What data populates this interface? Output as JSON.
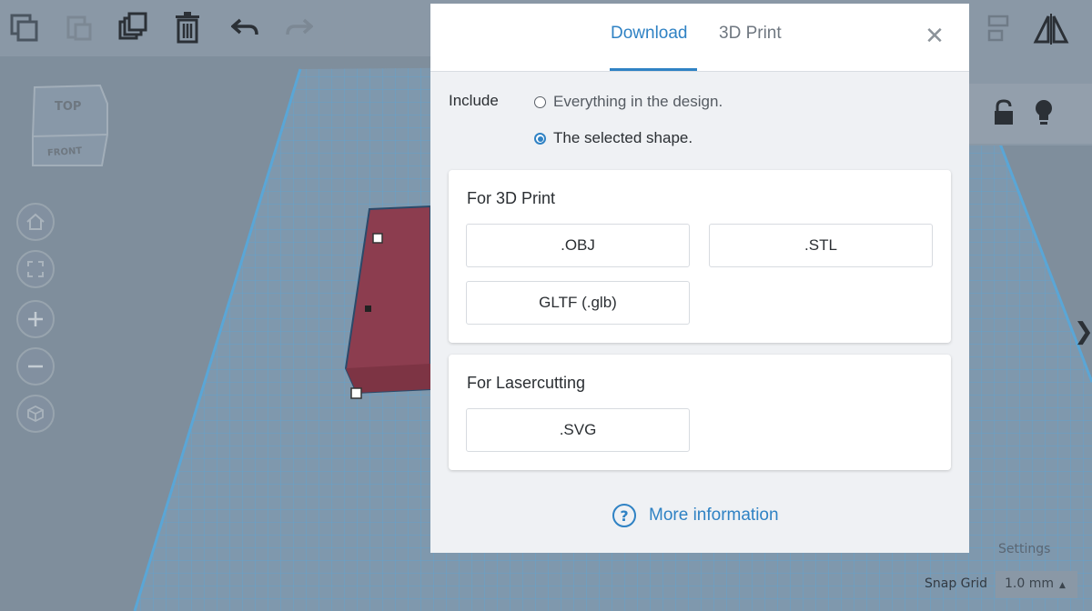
{
  "viewcube": {
    "top": "TOP",
    "front": "FRONT"
  },
  "modal": {
    "tabs": [
      {
        "label": "Download",
        "active": true
      },
      {
        "label": "3D Print",
        "active": false
      }
    ],
    "close_symbol": "✕",
    "include_label": "Include",
    "include_options": [
      {
        "label": "Everything in the design.",
        "selected": false
      },
      {
        "label": "The selected shape.",
        "selected": true
      }
    ],
    "sections": [
      {
        "title": "For 3D Print",
        "buttons": [
          ".OBJ",
          ".STL",
          "GLTF (.glb)"
        ]
      },
      {
        "title": "For Lasercutting",
        "buttons": [
          ".SVG"
        ]
      }
    ],
    "more_info": "More information"
  },
  "footer": {
    "settings_label": "Settings",
    "snap_grid_label": "Snap Grid",
    "snap_grid_value": "1.0 mm"
  },
  "colors": {
    "accent": "#2f82c4",
    "shape_fill": "#8c3d4f",
    "grid_line": "#5aa6d6"
  },
  "icons": [
    "copy-icon",
    "paste-icon",
    "duplicate-icon",
    "trash-icon",
    "undo-icon",
    "redo-icon",
    "align-icon",
    "mirror-icon",
    "lock-icon",
    "lightbulb-icon",
    "home-icon",
    "fit-view-icon",
    "zoom-in-icon",
    "zoom-out-icon",
    "perspective-icon"
  ]
}
